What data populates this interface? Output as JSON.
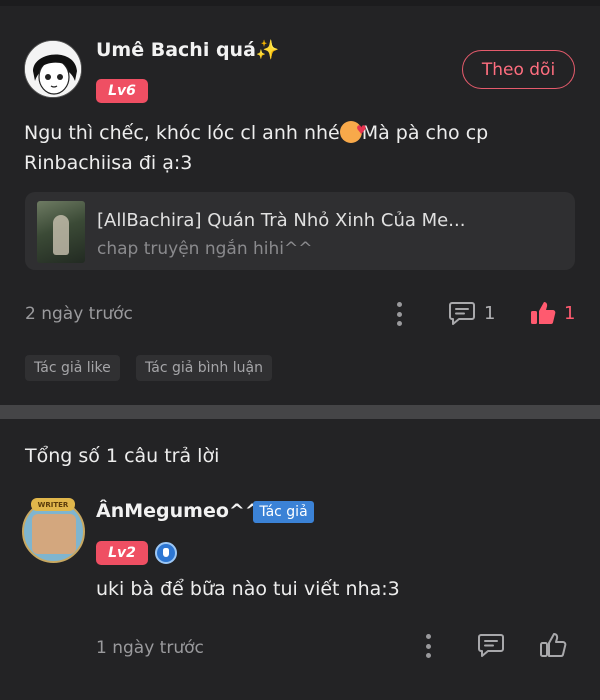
{
  "comment": {
    "username": "Umê Bachi quá✨",
    "level": "Lv6",
    "follow_label": "Theo dõi",
    "text_part1": "Ngu thì chếc, khóc lóc cl anh nhé",
    "text_part2": "Mà pà cho cp Rinbachiisa đi ạ:3",
    "book": {
      "title": "[AllBachira] Quán Trà Nhỏ Xinh Của Me...",
      "subtitle": "chap truyện ngắn hihi^^"
    },
    "time": "2 ngày trước",
    "comment_count": "1",
    "like_count": "1",
    "tags": [
      "Tác giả like",
      "Tác giả bình luận"
    ]
  },
  "replies_header": "Tổng số 1 câu trả lời",
  "reply": {
    "username": "ÂnMegumeo^^",
    "author_badge": "Tác giả",
    "level": "Lv2",
    "avatar_tag": "WRITER",
    "text": "uki bà để bữa nào tui viết nha:3",
    "time": "1 ngày trước"
  },
  "colors": {
    "background": "#232325",
    "accent": "#ef4f63",
    "like_active": "#ff5a6f",
    "author_badge": "#3b82d6"
  },
  "icons": {
    "more": "more-vertical-icon",
    "comment": "comment-icon",
    "like": "thumbs-up-icon",
    "vip": "vip-shield-icon"
  }
}
